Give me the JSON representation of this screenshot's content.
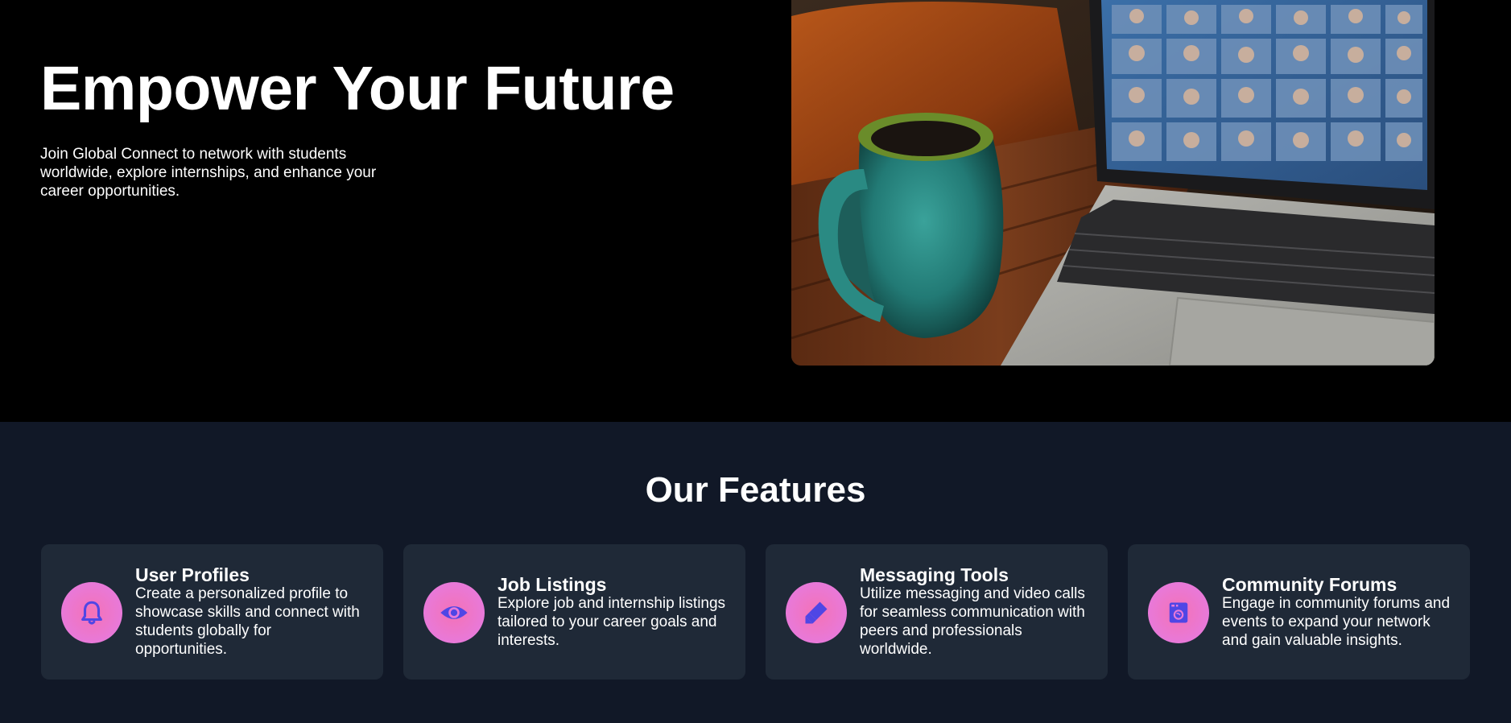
{
  "hero": {
    "title": "Empower Your Future",
    "description": "Join Global Connect to network with students worldwide, explore internships, and enhance your career opportunities."
  },
  "features": {
    "title": "Our Features",
    "items": [
      {
        "title": "User Profiles",
        "description": "Create a personalized profile to showcase skills and connect with students globally for opportunities.",
        "icon": "bell-icon"
      },
      {
        "title": "Job Listings",
        "description": "Explore job and internship listings tailored to your career goals and interests.",
        "icon": "eye-icon"
      },
      {
        "title": "Messaging Tools",
        "description": "Utilize messaging and video calls for seamless communication with peers and professionals worldwide.",
        "icon": "marker-icon"
      },
      {
        "title": "Community Forums",
        "description": "Engage in community forums and events to expand your network and gain valuable insights.",
        "icon": "washer-icon"
      }
    ]
  },
  "colors": {
    "hero_background": "#000000",
    "page_background": "#111827",
    "card_background": "#1f2937",
    "icon_circle": "#f472b6",
    "icon_glyph": "#4f46e5"
  }
}
